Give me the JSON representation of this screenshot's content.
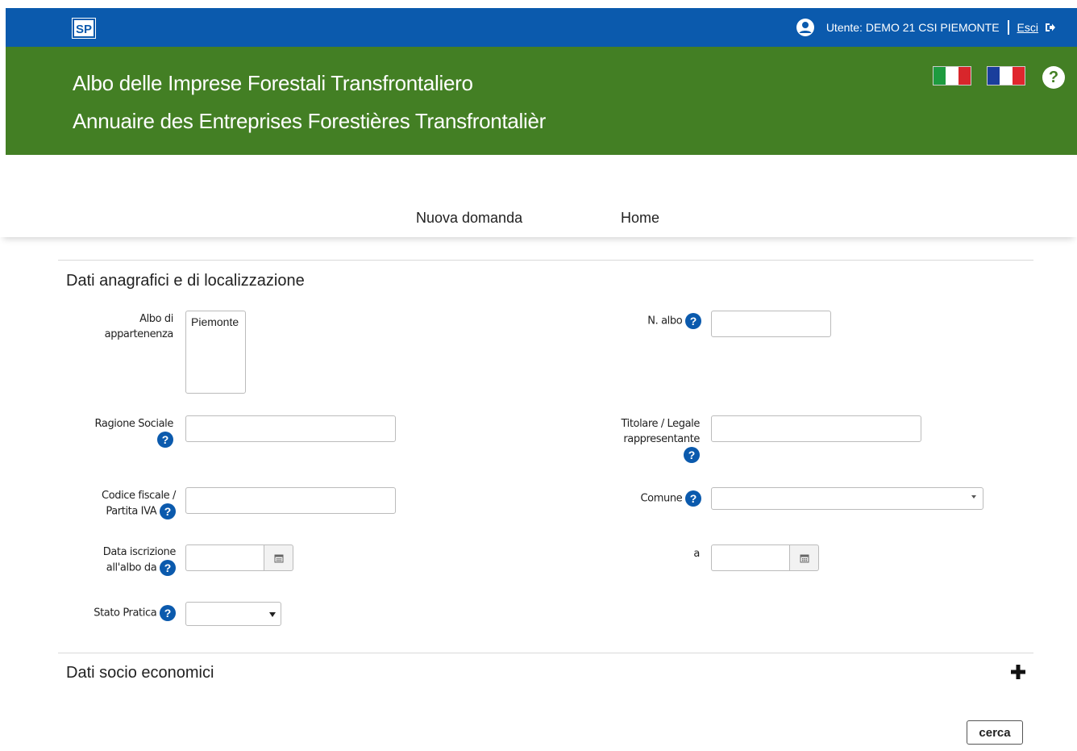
{
  "topbar": {
    "logo_text": "SP",
    "user_label": "Utente: DEMO 21 CSI PIEMONTE",
    "logout_label": "Esci",
    "icons": {
      "user": "user-circle-icon",
      "logout": "logout-icon"
    }
  },
  "header": {
    "title_it": "Albo delle Imprese Forestali Transfrontaliero",
    "title_fr": "Annuaire des Entreprises Forestières Transfrontalièr",
    "bg_color": "#437f24",
    "help_symbol": "?"
  },
  "nav": {
    "items": [
      {
        "label": "Nuova domanda"
      },
      {
        "label": "Home"
      }
    ]
  },
  "form": {
    "section1_title": "Dati anagrafici e di localizzazione",
    "albo_label": "Albo di appartenenza",
    "albo_options": [
      "Piemonte"
    ],
    "n_albo_label": "N. albo",
    "ragione_label": "Ragione Sociale",
    "titolare_label": "Titolare / Legale rappresentante",
    "codice_label": "Codice fiscale / Partita IVA",
    "comune_label": "Comune",
    "data_da_label": "Data iscrizione all'albo da",
    "data_a_label": "a",
    "stato_label": "Stato Pratica",
    "help_symbol": "?",
    "section2_title": "Dati socio economici",
    "search_label": "cerca"
  },
  "colors": {
    "topbar": "#0b5aad",
    "header": "#437f24",
    "help": "#0b5aad"
  }
}
